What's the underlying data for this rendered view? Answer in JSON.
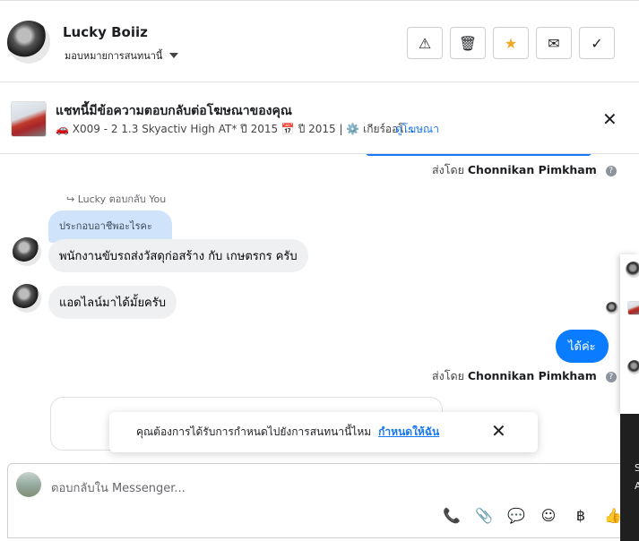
{
  "header": {
    "name": "Lucky Boiiz",
    "assign_label": "มอบหมายการสนทนานี้",
    "actions": [
      {
        "icon": "warning-icon",
        "glyph": "⚠"
      },
      {
        "icon": "trash-icon",
        "glyph": "🗑"
      },
      {
        "icon": "star-icon",
        "glyph": "★"
      },
      {
        "icon": "mail-icon",
        "glyph": "✉"
      },
      {
        "icon": "check-icon",
        "glyph": "✓"
      }
    ]
  },
  "ad": {
    "title": "แชทนี้มีข้อความตอบกลับต่อโฆษณาของคุณ",
    "subtitle": "🚗 X009 - 2 1.3 Skyactiv High AT* ปี 2015 📅 ปี 2015 | ⚙️ เกียร์ออโ...",
    "link": "ดูโฆษณา",
    "close_glyph": "✕"
  },
  "chat": {
    "sent_by_prefix": "ส่งโดย",
    "sender": "Chonnikan Pimkham",
    "help_glyph": "?",
    "reply_label": "Lucky ตอบกลับ You",
    "quote": "ประกอบอาชีพอะไรคะ",
    "msg1": "พนักงานขับรถส่งวัสดุก่อสร้าง กับ เกษตรกร ครับ",
    "msg2": "แอดไลน์มาได้มั้ยครับ",
    "my_msg": "ได้ค่ะ"
  },
  "toast": {
    "text": "คุณต้องการได้รับการกำหนดไปยังการสนทนานี้ไหม",
    "link": "กำหนดให้ฉัน",
    "close_glyph": "✕"
  },
  "composer": {
    "placeholder": "ตอบกลับใน Messenger...",
    "tools": [
      {
        "icon": "phone-plus-icon",
        "glyph": "📞"
      },
      {
        "icon": "paperclip-icon",
        "glyph": "📎"
      },
      {
        "icon": "speech-bubble-icon",
        "glyph": "💬"
      },
      {
        "icon": "emoji-icon",
        "glyph": "☺"
      },
      {
        "icon": "baht-icon",
        "glyph": "฿"
      },
      {
        "icon": "thumbs-up-icon",
        "glyph": "👍"
      }
    ]
  },
  "side": {
    "letters": [
      "S",
      "A"
    ]
  },
  "colors": {
    "accent": "#1877f2",
    "my_bubble": "#0a7cff",
    "quote_bubble": "#cfe3fb",
    "star": "#f5a623"
  }
}
